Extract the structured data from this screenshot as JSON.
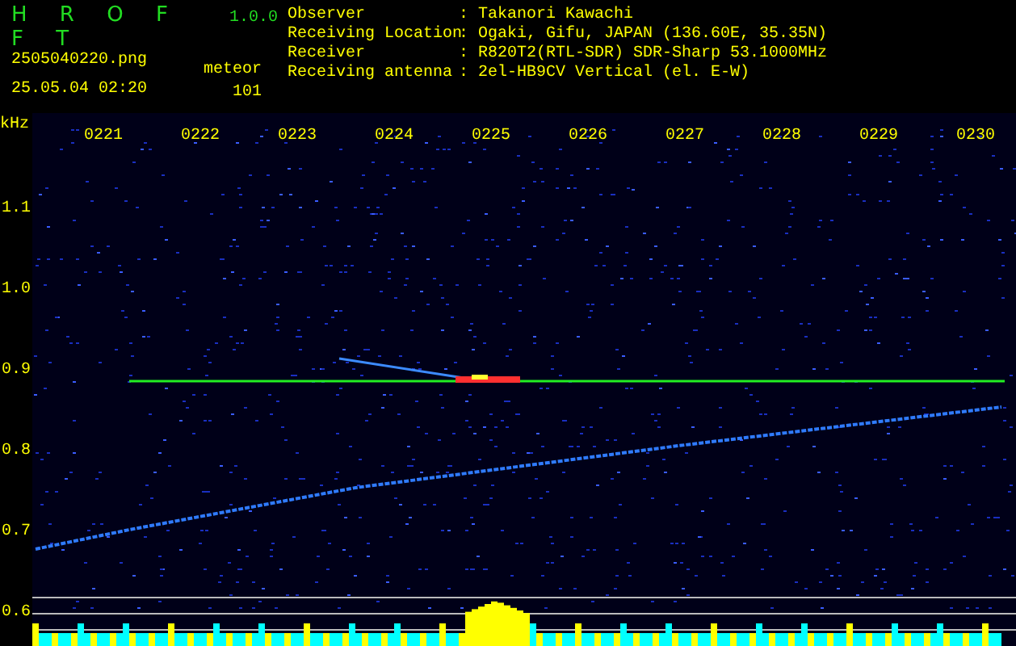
{
  "header": {
    "title": "H R O F F T",
    "version": "1.0.0",
    "filename": "2505040220.png",
    "datetime": "25.05.04 02:20",
    "count_label": "meteor",
    "count": "101"
  },
  "station_info": [
    {
      "label": "Observer",
      "value": ": Takanori Kawachi"
    },
    {
      "label": "Receiving Location",
      "value": ": Ogaki, Gifu, JAPAN (136.60E, 35.35N)"
    },
    {
      "label": "Receiver",
      "value": ": R820T2(RTL-SDR) SDR-Sharp 53.1000MHz"
    },
    {
      "label": "Receiving antenna",
      "value": ": 2el-HB9CV Vertical (el. E-W)"
    }
  ],
  "spectrogram": {
    "unit": "kHz",
    "time_labels": [
      "0221",
      "0222",
      "0223",
      "0224",
      "0225",
      "0226",
      "0227",
      "0228",
      "0229",
      "0230"
    ],
    "freq_labels": [
      "1.1",
      "1.0",
      "0.9",
      "0.8",
      "0.7",
      "0.6"
    ]
  }
}
